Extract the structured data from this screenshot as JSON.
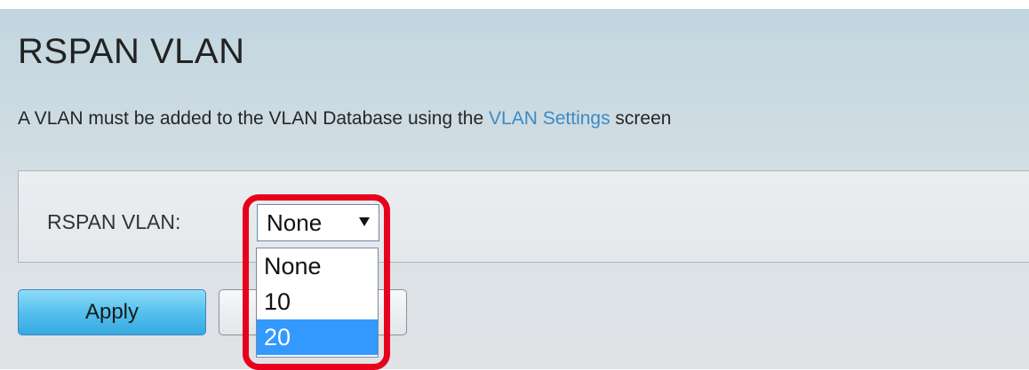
{
  "page": {
    "title": "RSPAN VLAN",
    "description_prefix": "A VLAN must be added to the VLAN Database using the ",
    "description_link": "VLAN Settings",
    "description_suffix": " screen"
  },
  "form": {
    "rspan_vlan_label": "RSPAN VLAN:",
    "rspan_vlan_value": "None",
    "rspan_vlan_options": [
      "None",
      "10",
      "20"
    ],
    "highlighted_option": "20"
  },
  "buttons": {
    "apply_label": "Apply",
    "cancel_label": ""
  },
  "colors": {
    "link": "#3a8bc6",
    "selected_option": "#3399ff",
    "highlight_ring": "#e8001c",
    "apply_button": "#55c0ee"
  }
}
